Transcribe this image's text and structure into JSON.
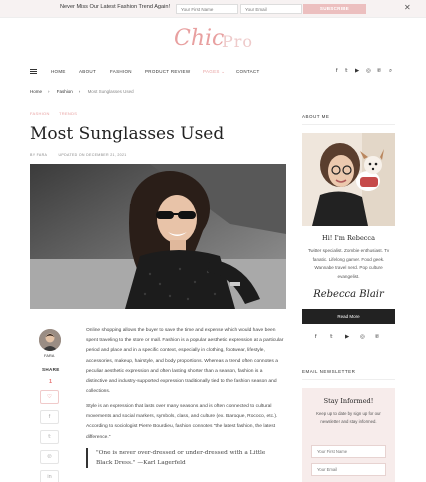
{
  "promo": {
    "message": "Never Miss Our Latest Fashion Trend Again!",
    "first_name_placeholder": "Your First Name",
    "email_placeholder": "Your Email",
    "subscribe_label": "SUBSCRIBE",
    "close_glyph": "✕"
  },
  "logo": {
    "script": "Chic",
    "text": "Pro"
  },
  "nav": {
    "items": [
      "HOME",
      "ABOUT",
      "FASHION",
      "PRODUCT REVIEW",
      "PAGES",
      "CONTACT"
    ],
    "active_index": 4,
    "social_icons": [
      "facebook-icon",
      "twitter-icon",
      "youtube-icon",
      "instagram-icon",
      "pinterest-icon",
      "search-icon"
    ],
    "social_glyphs": [
      "f",
      "𝕥",
      "▶",
      "◎",
      "℗",
      "⌕"
    ]
  },
  "breadcrumb": {
    "home": "Home",
    "section": "Fashion",
    "current": "Most Sunglasses Used"
  },
  "article": {
    "categories": [
      "FASHION",
      "TRENDS"
    ],
    "title": "Most Sunglasses Used",
    "author": "BY FARA",
    "date": "UPDATED ON DECEMBER 21, 2021",
    "author_name": "FARA",
    "share_label": "SHARE",
    "share_count": "1",
    "share_glyphs": [
      "♡",
      "f",
      "𝕥",
      "℗",
      "in"
    ],
    "para1": "Online shopping allows the buyer to save the time and expense which would have been spent traveling to the store or mall. Fashion is a popular aesthetic expression at a particular period and place and in a specific context, especially in clothing, footwear, lifestyle, accessories, makeup, hairstyle, and body proportions. Whereas a trend often connotes a peculiar aesthetic expression and often lasting shorter than a season, fashion is a distinctive and industry-supported expression traditionally tied to the fashion season and collections.",
    "para2": "Style is an expression that lasts over many seasons and is often connected to cultural movements and social markers, symbols, class, and culture (ex. Baroque, Rococo, etc.). According to sociologist Pierre Bourdieu, fashion connotes \"the latest fashion, the latest difference.\"",
    "quote": "\"One is never over-dressed or under-dressed with a Little Black Dress.\" —Karl Lagerfeld"
  },
  "sidebar": {
    "about_heading": "ABOUT ME",
    "hi": "Hi! I'm Rebecca",
    "bio": "Twitter specialist. Zombie enthusiast. Tv fanatic. Lifelong gamer. Food geek. Wannabe travel nerd. Pop culture evangelist.",
    "signature": "Rebecca Blair",
    "read_more": "Read More",
    "social_glyphs": [
      "f",
      "𝕥",
      "▶",
      "◎",
      "℗"
    ],
    "newsletter_heading": "EMAIL NEWSLETTER",
    "newsletter_title": "Stay Informed!",
    "newsletter_desc": "Keep up to date by sign up for our newsletter and stay informed.",
    "first_name_placeholder": "Your First Name",
    "email_placeholder": "Your Email"
  }
}
